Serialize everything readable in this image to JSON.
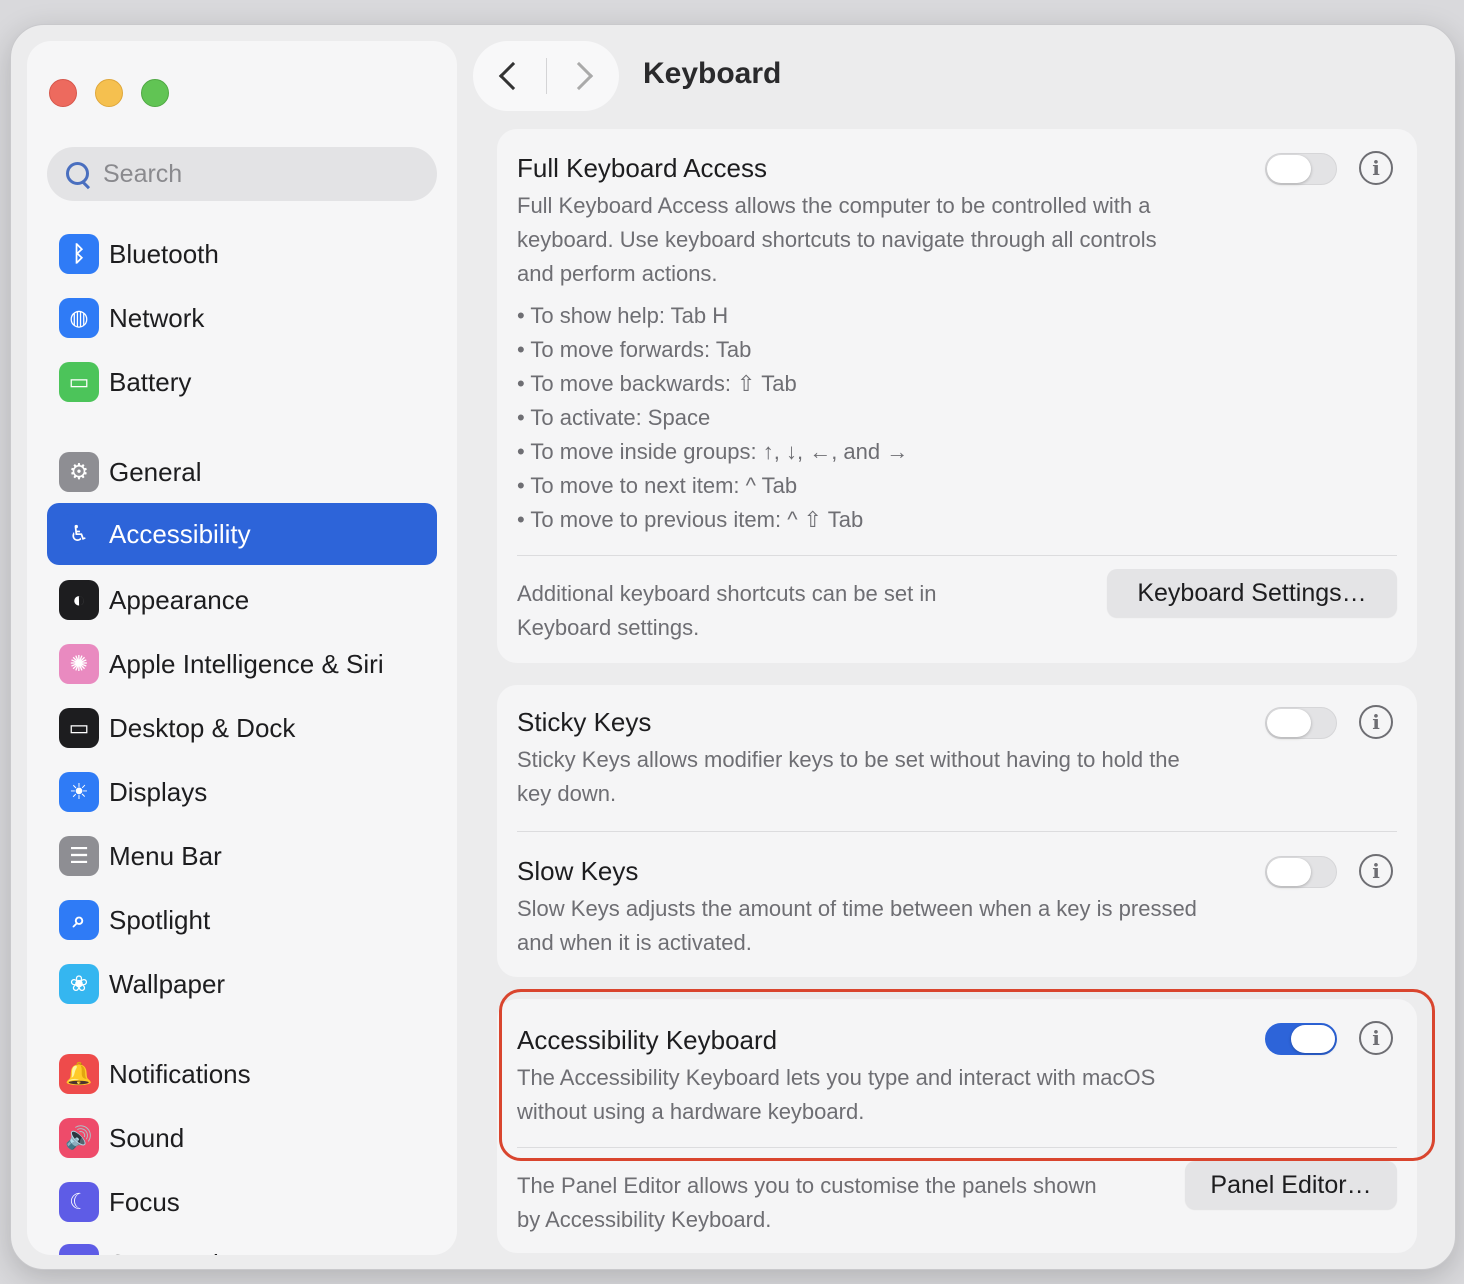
{
  "window": {
    "title": "Keyboard"
  },
  "sidebar": {
    "search_placeholder": "Search",
    "items": [
      {
        "label": "Bluetooth",
        "icon": "bluetooth-icon",
        "color": "#2f7bf6",
        "glyph": "ᛒ"
      },
      {
        "label": "Network",
        "icon": "globe-icon",
        "color": "#2f7bf6",
        "glyph": "◍"
      },
      {
        "label": "Battery",
        "icon": "battery-icon",
        "color": "#4cc45a",
        "glyph": "▭"
      },
      {
        "label": "General",
        "icon": "gear-icon",
        "color": "#8e8e93",
        "glyph": "⚙"
      },
      {
        "label": "Accessibility",
        "icon": "accessibility-icon",
        "color": "#2d64d9",
        "glyph": "♿"
      },
      {
        "label": "Appearance",
        "icon": "appearance-icon",
        "color": "#1d1d1f",
        "glyph": "◐"
      },
      {
        "label": "Apple Intelligence & Siri",
        "icon": "siri-icon",
        "color": "#e98ac0",
        "glyph": "✺"
      },
      {
        "label": "Desktop & Dock",
        "icon": "dock-icon",
        "color": "#1d1d1f",
        "glyph": "▭"
      },
      {
        "label": "Displays",
        "icon": "brightness-icon",
        "color": "#2f7bf6",
        "glyph": "☀"
      },
      {
        "label": "Menu Bar",
        "icon": "menubar-icon",
        "color": "#8e8e93",
        "glyph": "☰"
      },
      {
        "label": "Spotlight",
        "icon": "spotlight-icon",
        "color": "#2f7bf6",
        "glyph": "⌕"
      },
      {
        "label": "Wallpaper",
        "icon": "wallpaper-icon",
        "color": "#35b6f0",
        "glyph": "❀"
      },
      {
        "label": "Notifications",
        "icon": "bell-icon",
        "color": "#ee4b4b",
        "glyph": "🔔"
      },
      {
        "label": "Sound",
        "icon": "speaker-icon",
        "color": "#ee4b6a",
        "glyph": "🔊"
      },
      {
        "label": "Focus",
        "icon": "moon-icon",
        "color": "#5e5ce6",
        "glyph": "☾"
      },
      {
        "label": "Screen Time",
        "icon": "hourglass-icon",
        "color": "#5e5ce6",
        "glyph": "⧗"
      }
    ],
    "active": "Accessibility"
  },
  "full_keyboard_access": {
    "title": "Full Keyboard Access",
    "enabled": false,
    "desc_lines": [
      "Full Keyboard Access allows the computer to be controlled with a",
      "keyboard. Use keyboard shortcuts to navigate through all controls",
      "and perform actions."
    ],
    "shortcuts": [
      "• To show help: Tab H",
      "• To move forwards: Tab",
      "• To move backwards: ⇧ Tab",
      "• To activate: Space",
      "• To move inside groups: ↑, ↓, ←, and →",
      "• To move to next item: ^ Tab",
      "• To move to previous item: ^ ⇧ Tab"
    ],
    "footer_lines": [
      "Additional keyboard shortcuts can be set in",
      "Keyboard settings."
    ],
    "button_label": "Keyboard Settings…"
  },
  "sticky_keys": {
    "title": "Sticky Keys",
    "enabled": false,
    "desc_lines": [
      "Sticky Keys allows modifier keys to be set without having to hold the",
      "key down."
    ]
  },
  "slow_keys": {
    "title": "Slow Keys",
    "enabled": false,
    "desc_lines": [
      "Slow Keys adjusts the amount of time between when a key is pressed",
      "and when it is activated."
    ]
  },
  "accessibility_keyboard": {
    "title": "Accessibility Keyboard",
    "enabled": true,
    "desc_lines": [
      "The Accessibility Keyboard lets you type and interact with macOS",
      "without using a hardware keyboard."
    ],
    "footer_lines": [
      "The Panel Editor allows you to customise the panels shown",
      "by Accessibility Keyboard."
    ],
    "button_label": "Panel Editor…"
  },
  "info_glyph": "i"
}
